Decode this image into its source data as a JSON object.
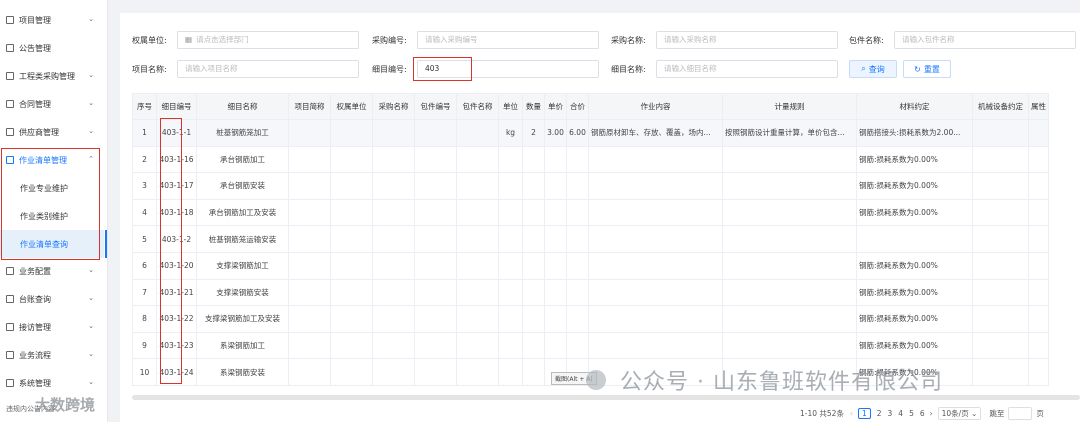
{
  "sidebar": {
    "items": [
      {
        "label": "项目管理"
      },
      {
        "label": "公告管理"
      },
      {
        "label": "工程类采购管理"
      },
      {
        "label": "合同管理"
      },
      {
        "label": "供应商管理"
      },
      {
        "label": "作业清单管理"
      },
      {
        "label": "业务配置"
      },
      {
        "label": "台账查询"
      },
      {
        "label": "接访管理"
      },
      {
        "label": "业务流程"
      },
      {
        "label": "系统管理"
      }
    ],
    "subitems": [
      {
        "label": "作业专业维护"
      },
      {
        "label": "作业类别维护"
      },
      {
        "label": "作业清单查询"
      }
    ],
    "footer": "违规内公告内容"
  },
  "filters": {
    "org_label": "权属单位:",
    "org_placeholder": "请点击选择部门",
    "purchase_no_label": "采购编号:",
    "purchase_no_placeholder": "请输入采购编号",
    "purchase_name_label": "采购名称:",
    "purchase_name_placeholder": "请输入采购名称",
    "package_name_label": "包件名称:",
    "package_name_placeholder": "请输入包件名称",
    "project_name_label": "项目名称:",
    "project_name_placeholder": "请输入项目名称",
    "item_no_label": "细目编号:",
    "item_no_value": "403",
    "item_name_label": "细目名称:",
    "item_name_placeholder": "请输入细目名称",
    "search_label": "查询",
    "reset_label": "重置"
  },
  "table": {
    "headers": [
      "序号",
      "细目编号",
      "细目名称",
      "项目简称",
      "权属单位",
      "采购名称",
      "包件编号",
      "包件名称",
      "单位",
      "数量",
      "单价",
      "合价",
      "作业内容",
      "计量规则",
      "材料约定",
      "机械设备约定",
      "属性"
    ],
    "rows": [
      [
        "1",
        "403-1-1",
        "桩基钢筋笼加工",
        "",
        "",
        "",
        "",
        "",
        "kg",
        "2",
        "3.00",
        "6.00",
        "钢筋原材卸车、存放、覆盖，场内...",
        "按照钢筋设计重量计算，单价包含...",
        "钢筋搭接头:损耗系数为2.00...",
        ""
      ],
      [
        "2",
        "403-1-16",
        "承台钢筋加工",
        "",
        "",
        "",
        "",
        "",
        "",
        "",
        "",
        "",
        "",
        "",
        "钢筋:损耗系数为0.00%",
        ""
      ],
      [
        "3",
        "403-1-17",
        "承台钢筋安装",
        "",
        "",
        "",
        "",
        "",
        "",
        "",
        "",
        "",
        "",
        "",
        "钢筋:损耗系数为0.00%",
        ""
      ],
      [
        "4",
        "403-1-18",
        "承台钢筋加工及安装",
        "",
        "",
        "",
        "",
        "",
        "",
        "",
        "",
        "",
        "",
        "",
        "钢筋:损耗系数为0.00%",
        ""
      ],
      [
        "5",
        "403-1-2",
        "桩基钢筋笼运输安装",
        "",
        "",
        "",
        "",
        "",
        "",
        "",
        "",
        "",
        "",
        "",
        "",
        ""
      ],
      [
        "6",
        "403-1-20",
        "支撑梁钢筋加工",
        "",
        "",
        "",
        "",
        "",
        "",
        "",
        "",
        "",
        "",
        "",
        "钢筋:损耗系数为0.00%",
        ""
      ],
      [
        "7",
        "403-1-21",
        "支撑梁钢筋安装",
        "",
        "",
        "",
        "",
        "",
        "",
        "",
        "",
        "",
        "",
        "",
        "钢筋:损耗系数为0.00%",
        ""
      ],
      [
        "8",
        "403-1-22",
        "支撑梁钢筋加工及安装",
        "",
        "",
        "",
        "",
        "",
        "",
        "",
        "",
        "",
        "",
        "",
        "钢筋:损耗系数为0.00%",
        ""
      ],
      [
        "9",
        "403-1-23",
        "系梁钢筋加工",
        "",
        "",
        "",
        "",
        "",
        "",
        "",
        "",
        "",
        "",
        "",
        "钢筋:损耗系数为0.00%",
        ""
      ],
      [
        "10",
        "403-1-24",
        "系梁钢筋安装",
        "",
        "",
        "",
        "",
        "",
        "",
        "",
        "",
        "",
        "",
        "",
        "钢筋:损耗系数为0.00%",
        ""
      ]
    ]
  },
  "pager": {
    "total": "1-10 共52条",
    "pages": [
      "1",
      "2",
      "3",
      "4",
      "5",
      "6"
    ],
    "page_size": "10条/页",
    "jump_label": "跳至",
    "page_unit": "页"
  },
  "overlay": {
    "watermark": "公众号 · 山东鲁班软件有限公司",
    "watermark2": "大数跨境",
    "tooltip": "截图(Alt + A)"
  },
  "colors": {
    "accent": "#1677ff",
    "highlight": "#d9342b"
  }
}
